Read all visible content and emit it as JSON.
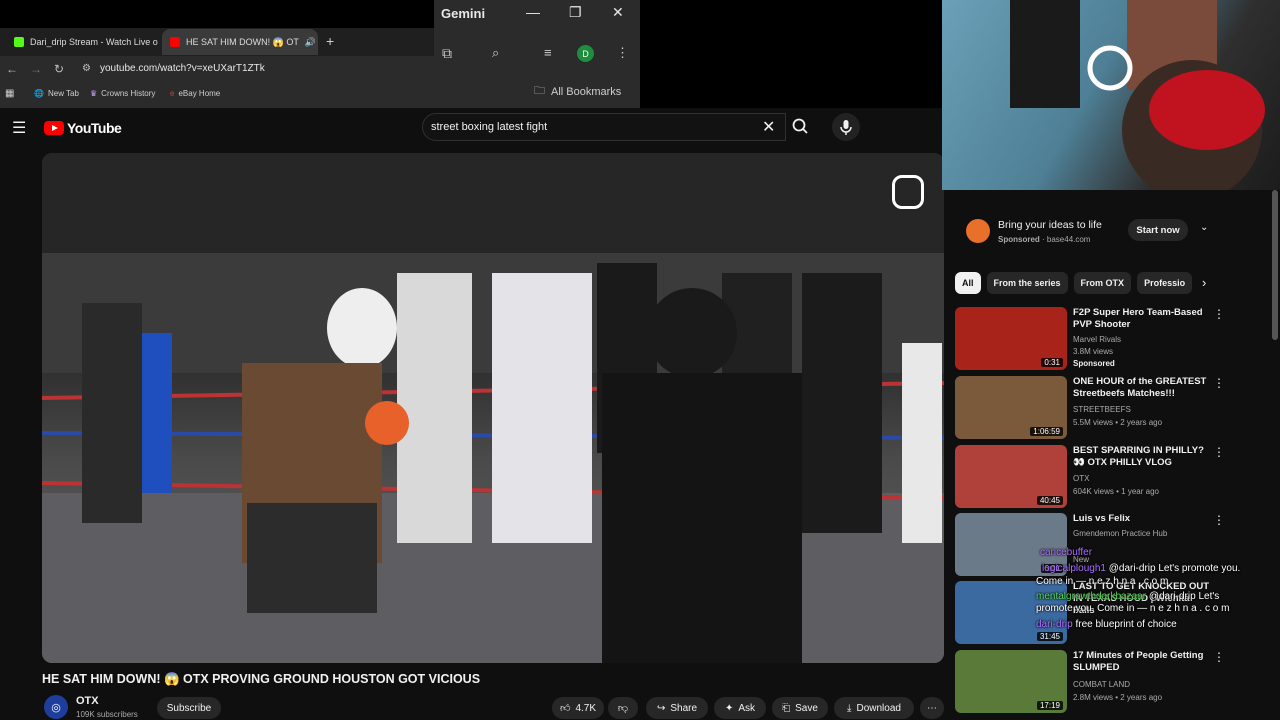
{
  "browser": {
    "tabs": [
      {
        "label": "Dari_drip Stream - Watch Live o",
        "active": false,
        "favicon_color": "#53fc18"
      },
      {
        "label": "HE SAT HIM DOWN! 😱 OT",
        "active": true,
        "favicon_color": "#ff0000"
      }
    ],
    "new_tab_symbol": "+",
    "url": "youtube.com/watch?v=xeUXarT1ZTk",
    "bookmarks": [
      "New Tab",
      "Crowns History",
      "eBay Home"
    ],
    "gemini_title": "Gemini",
    "profile_initial": "D",
    "all_bookmarks": "All Bookmarks"
  },
  "youtube": {
    "wordmark": "YouTube",
    "search_query": "street boxing  latest fight",
    "video": {
      "title": "HE SAT HIM DOWN! 😱 OTX PROVING GROUND HOUSTON GOT VICIOUS",
      "channel": "OTX",
      "subscribers": "109K subscribers",
      "subscribe_label": "Subscribe",
      "likes": "4.7K",
      "share_label": "Share",
      "ask_label": "Ask",
      "save_label": "Save",
      "download_label": "Download"
    },
    "ad": {
      "title": "Bring your ideas to life",
      "sponsored": "Sponsored",
      "domain": "base44.com",
      "cta": "Start now"
    },
    "chips": [
      "All",
      "From the series",
      "From OTX",
      "Professio"
    ],
    "recommendations": [
      {
        "title": "F2P Super Hero Team-Based PVP Shooter",
        "channel": "Marvel Rivals",
        "meta": "3.8M views",
        "extra": "Sponsored",
        "duration": "0:31",
        "thumb_color": "#a8231a"
      },
      {
        "title": "ONE HOUR of the GREATEST Streetbeefs Matches!!!",
        "channel": "STREETBEEFS",
        "meta": "5.5M views • 2 years ago",
        "extra": "",
        "duration": "1:06:59",
        "thumb_color": "#7a5a3a"
      },
      {
        "title": "BEST SPARRING IN PHILLY? 👀 OTX PHILLY VLOG",
        "channel": "OTX",
        "meta": "604K views • 1 year ago",
        "extra": "",
        "duration": "40:45",
        "thumb_color": "#b0413a"
      },
      {
        "title": "Luis vs Felix",
        "channel": "Gmendemon Practice Hub",
        "meta": "",
        "extra": "New",
        "duration": "6:01",
        "thumb_color": "#6b7a88"
      },
      {
        "title": "LAST TO GET KNOCKED OUT IN TEXAS HOOD | Wichita Falls",
        "channel": "",
        "meta": "",
        "extra": "",
        "duration": "31:45",
        "thumb_color": "#3a6aa0"
      },
      {
        "title": "17 Minutes of People Getting SLUMPED",
        "channel": "COMBAT LAND",
        "meta": "2.8M views • 2 years ago",
        "extra": "",
        "duration": "17:19",
        "thumb_color": "#5a7a3a"
      }
    ]
  },
  "chat": [
    {
      "user": "cancebuffer",
      "text": ""
    },
    {
      "user": "logicalplough1",
      "text": "@dari-drip Let's promote you."
    },
    {
      "user": "",
      "text": "Come in — n e z h n a . c o m"
    },
    {
      "user": "mentalgrowthdarkbazaar",
      "text": "@dari-drip Let's"
    },
    {
      "user": "",
      "text": "promote you. Come in — n e z h n a . c o m"
    },
    {
      "user": "dari-drip",
      "text": "free blueprint of choice"
    }
  ]
}
